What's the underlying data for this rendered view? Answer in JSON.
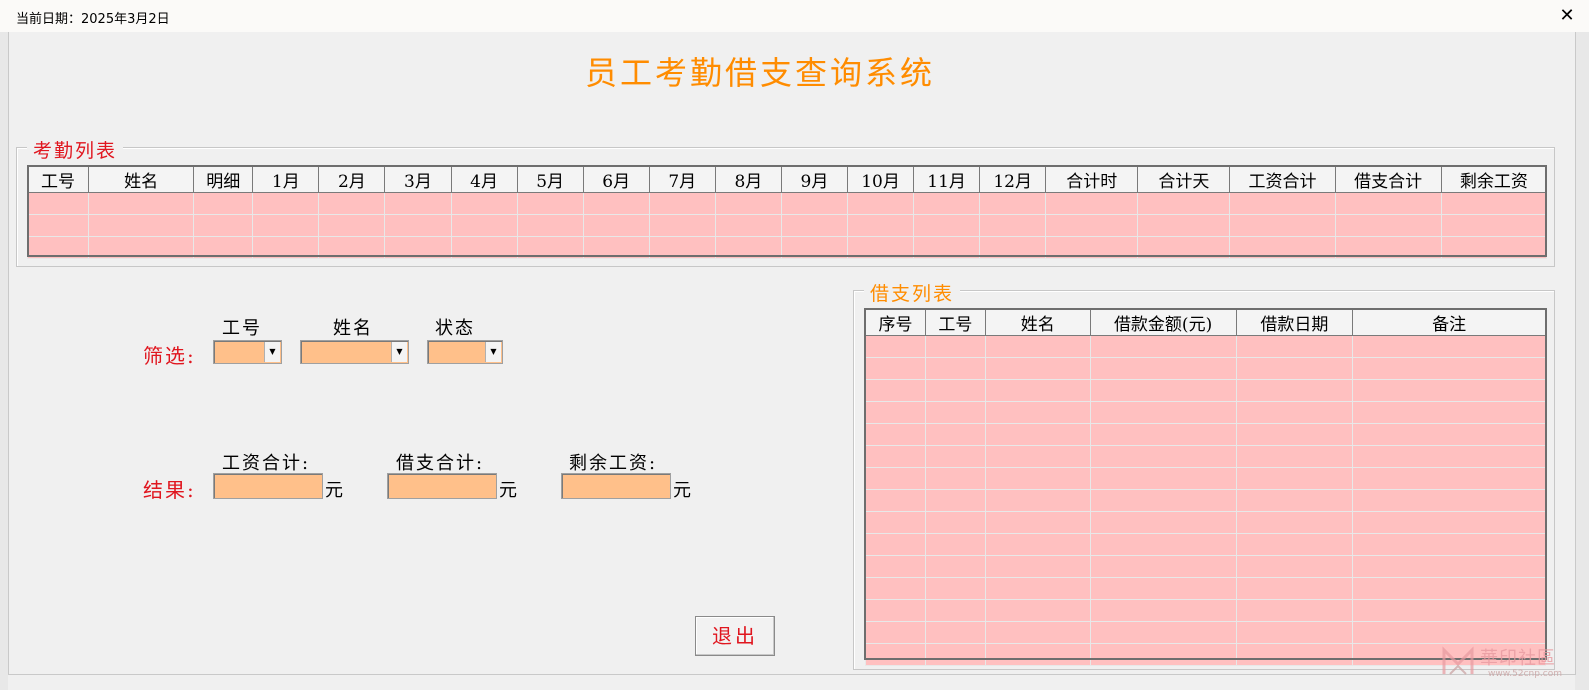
{
  "window": {
    "date_label": "当前日期：2025年3月2日",
    "close_glyph": "✕",
    "app_title": "员工考勤借支查询系统"
  },
  "colors": {
    "title": "#ff8c00",
    "group_label_attendance": "#e0161f",
    "group_label_loan": "#ff8c00",
    "grid_cell": "#ffc0c0",
    "input_fill": "#ffc08a",
    "label_red": "#e0161f"
  },
  "attendance": {
    "group_label": "考勤列表",
    "columns": [
      "工号",
      "姓名",
      "明细",
      "1月",
      "2月",
      "3月",
      "4月",
      "5月",
      "6月",
      "7月",
      "8月",
      "9月",
      "10月",
      "11月",
      "12月",
      "合计时",
      "合计天",
      "工资合计",
      "借支合计",
      "剩余工资"
    ],
    "row_count": 3
  },
  "loan": {
    "group_label": "借支列表",
    "columns": [
      "序号",
      "工号",
      "姓名",
      "借款金额(元)",
      "借款日期",
      "备注"
    ],
    "row_count": 15
  },
  "filter": {
    "label": "筛选:",
    "fields": [
      {
        "label": "工号",
        "value": ""
      },
      {
        "label": "姓名",
        "value": ""
      },
      {
        "label": "状态",
        "value": ""
      }
    ]
  },
  "result": {
    "label": "结果:",
    "fields": [
      {
        "label": "工资合计:",
        "value": "",
        "unit": "元"
      },
      {
        "label": "借支合计:",
        "value": "",
        "unit": "元"
      },
      {
        "label": "剩余工资:",
        "value": "",
        "unit": "元"
      }
    ]
  },
  "exit_button": "退出",
  "watermark": {
    "text": "華印社區",
    "url": "www.52cnp.com"
  }
}
